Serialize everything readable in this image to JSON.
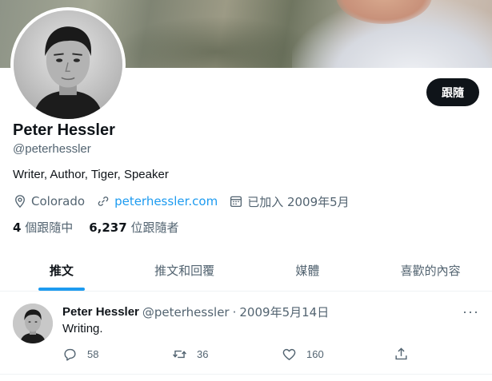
{
  "profile": {
    "name": "Peter Hessler",
    "handle": "@peterhessler",
    "bio": "Writer, Author, Tiger, Speaker",
    "location": "Colorado",
    "website": "peterhessler.com",
    "joined": "已加入 2009年5月",
    "follow_label": "跟隨"
  },
  "stats": {
    "following_count": "4",
    "following_label": "個跟隨中",
    "followers_count": "6,237",
    "followers_label": "位跟隨者"
  },
  "tabs": [
    {
      "label": "推文",
      "active": true
    },
    {
      "label": "推文和回覆",
      "active": false
    },
    {
      "label": "媒體",
      "active": false
    },
    {
      "label": "喜歡的內容",
      "active": false
    }
  ],
  "tweet": {
    "author_name": "Peter Hessler",
    "author_handle": "@peterhessler",
    "separator": "·",
    "date": "2009年5月14日",
    "text": "Writing.",
    "more": "···",
    "reply_count": "58",
    "retweet_count": "36",
    "like_count": "160"
  },
  "icons": {
    "location": "location-pin-icon",
    "link": "link-icon",
    "calendar": "calendar-icon",
    "reply": "reply-icon",
    "retweet": "retweet-icon",
    "like": "heart-icon",
    "share": "share-icon"
  },
  "colors": {
    "accent": "#1d9bf0",
    "text": "#0f1419",
    "secondary": "#536471",
    "follow_button": "#0f1419"
  }
}
